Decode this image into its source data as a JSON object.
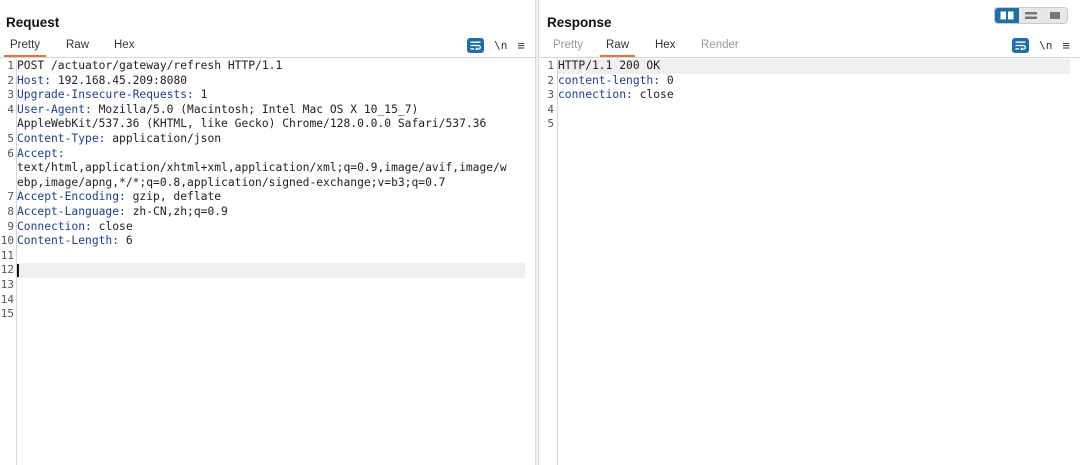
{
  "request": {
    "title": "Request",
    "tabs": [
      "Pretty",
      "Raw",
      "Hex"
    ],
    "active_tab": "Pretty",
    "tools": {
      "newline_label": "\\n"
    },
    "lines": [
      {
        "n": "1",
        "key": "",
        "text": "POST /actuator/gateway/refresh HTTP/1.1"
      },
      {
        "n": "2",
        "key": "Host:",
        "text": " 192.168.45.209:8080"
      },
      {
        "n": "3",
        "key": "Upgrade-Insecure-Requests:",
        "text": " 1"
      },
      {
        "n": "4",
        "key": "User-Agent:",
        "text": " Mozilla/5.0 (Macintosh; Intel Mac OS X 10_15_7)"
      },
      {
        "n": "",
        "key": "",
        "text": "AppleWebKit/537.36 (KHTML, like Gecko) Chrome/128.0.0.0 Safari/537.36"
      },
      {
        "n": "5",
        "key": "Content-Type:",
        "text": " application/json"
      },
      {
        "n": "6",
        "key": "Accept:",
        "text": ""
      },
      {
        "n": "",
        "key": "",
        "text": "text/html,application/xhtml+xml,application/xml;q=0.9,image/avif,image/w"
      },
      {
        "n": "",
        "key": "",
        "text": "ebp,image/apng,*/*;q=0.8,application/signed-exchange;v=b3;q=0.7"
      },
      {
        "n": "7",
        "key": "Accept-Encoding:",
        "text": " gzip, deflate"
      },
      {
        "n": "8",
        "key": "Accept-Language:",
        "text": " zh-CN,zh;q=0.9"
      },
      {
        "n": "9",
        "key": "Connection:",
        "text": " close"
      },
      {
        "n": "10",
        "key": "Content-Length:",
        "text": " 6"
      },
      {
        "n": "11",
        "key": "",
        "text": ""
      },
      {
        "n": "12",
        "key": "",
        "text": "",
        "caret": true
      },
      {
        "n": "13",
        "key": "",
        "text": ""
      },
      {
        "n": "14",
        "key": "",
        "text": ""
      },
      {
        "n": "15",
        "key": "",
        "text": ""
      }
    ]
  },
  "response": {
    "title": "Response",
    "tabs": [
      "Pretty",
      "Raw",
      "Hex",
      "Render"
    ],
    "active_tab": "Raw",
    "disabled_tabs": [
      "Pretty",
      "Render"
    ],
    "tools": {
      "newline_label": "\\n"
    },
    "lines": [
      {
        "n": "1",
        "key": "",
        "text": "HTTP/1.1 200 OK",
        "highlight": true
      },
      {
        "n": "2",
        "key": "content-length:",
        "text": " 0"
      },
      {
        "n": "3",
        "key": "connection:",
        "text": " close"
      },
      {
        "n": "4",
        "key": "",
        "text": ""
      },
      {
        "n": "5",
        "key": "",
        "text": ""
      }
    ]
  },
  "layout_toggle": {
    "active": 0,
    "options": [
      "side-by-side",
      "stacked-horizontal",
      "single"
    ]
  },
  "colors": {
    "accent": "#1f6fa8",
    "tab_underline": "#e8743b",
    "header_key": "#1d3f8f"
  }
}
